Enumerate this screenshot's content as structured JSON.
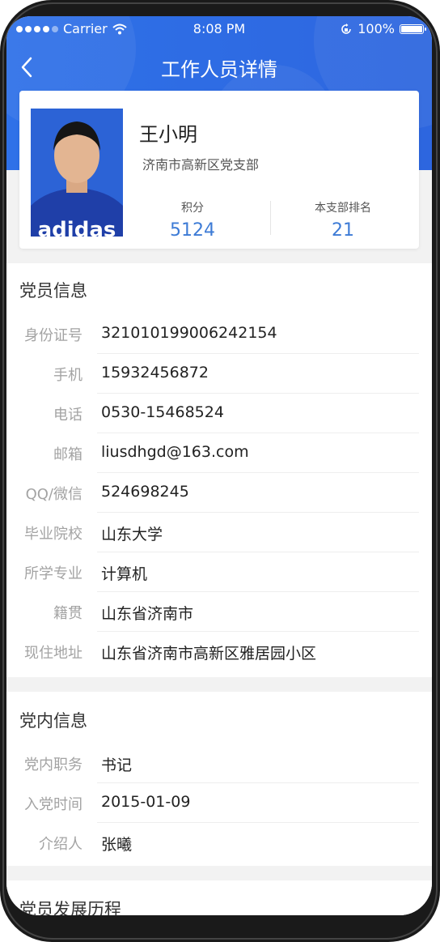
{
  "status_bar": {
    "carrier": "Carrier",
    "time": "8:08 PM",
    "battery": "100%"
  },
  "nav": {
    "title": "工作人员详情"
  },
  "profile": {
    "name": "王小明",
    "org": "济南市高新区党支部",
    "avatar_text": "adidas",
    "stats": [
      {
        "label": "积分",
        "value": "5124"
      },
      {
        "label": "本支部排名",
        "value": "21"
      }
    ]
  },
  "member_info": {
    "title": "党员信息",
    "rows": [
      {
        "label": "身份证号",
        "value": "321010199006242154"
      },
      {
        "label": "手机",
        "value": "15932456872"
      },
      {
        "label": "电话",
        "value": "0530-15468524"
      },
      {
        "label": "邮箱",
        "value": "liusdhgd@163.com"
      },
      {
        "label": "QQ/微信",
        "value": "524698245"
      },
      {
        "label": "毕业院校",
        "value": "山东大学"
      },
      {
        "label": "所学专业",
        "value": "计算机"
      },
      {
        "label": "籍贯",
        "value": "山东省济南市"
      },
      {
        "label": "现住地址",
        "value": "山东省济南市高新区雅居园小区"
      }
    ]
  },
  "party_info": {
    "title": "党内信息",
    "rows": [
      {
        "label": "党内职务",
        "value": "书记"
      },
      {
        "label": "入党时间",
        "value": "2015-01-09"
      },
      {
        "label": "介绍人",
        "value": "张曦"
      }
    ]
  },
  "history": {
    "title": "党员发展历程"
  },
  "colors": {
    "header_blue": "#2f71e8",
    "stat_blue": "#3d7bd6"
  }
}
